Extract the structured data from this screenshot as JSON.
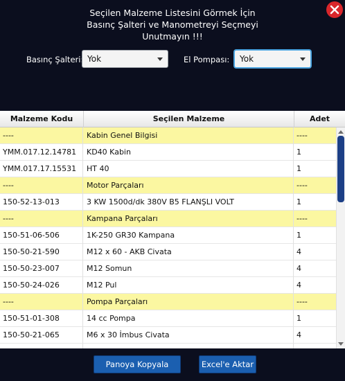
{
  "dialog": {
    "warning_lines": [
      "Seçilen Malzeme Listesini Görmek İçin",
      "Basınç Şalteri ve Manometreyi Seçmeyi",
      "Unutmayın !!!"
    ],
    "close_icon": "close-icon"
  },
  "filters": {
    "pressure_switch_label": "Basınç Şalteri:",
    "pressure_switch_value": "Yok",
    "hand_pump_label": "El Pompası:",
    "hand_pump_value": "Yok"
  },
  "table": {
    "columns": [
      "Malzeme Kodu",
      "Seçilen Malzeme",
      "Adet"
    ],
    "rows": [
      {
        "type": "section",
        "code": "----",
        "name": "Kabin Genel Bilgisi",
        "qty": "----"
      },
      {
        "type": "item",
        "code": "YMM.017.12.14781",
        "name": "KD40 Kabin",
        "qty": "1"
      },
      {
        "type": "item",
        "code": "YMM.017.17.15531",
        "name": "HT 40",
        "qty": "1"
      },
      {
        "type": "section",
        "code": "----",
        "name": "Motor Parçaları",
        "qty": "----"
      },
      {
        "type": "item",
        "code": "150-52-13-013",
        "name": "3 KW 1500d/dk 380V B5 FLANŞLI VOLT",
        "qty": "1"
      },
      {
        "type": "section",
        "code": "----",
        "name": "Kampana Parçaları",
        "qty": "----"
      },
      {
        "type": "item",
        "code": "150-51-06-506",
        "name": "1K-250 GR30 Kampana",
        "qty": "1"
      },
      {
        "type": "item",
        "code": "150-50-21-590",
        "name": "M12 x 60 - AKB Civata",
        "qty": "4"
      },
      {
        "type": "item",
        "code": "150-50-23-007",
        "name": "M12 Somun",
        "qty": "4"
      },
      {
        "type": "item",
        "code": "150-50-24-026",
        "name": "M12 Pul",
        "qty": "4"
      },
      {
        "type": "section",
        "code": "----",
        "name": "Pompa Parçaları",
        "qty": "----"
      },
      {
        "type": "item",
        "code": "150-51-01-308",
        "name": "14 cc Pompa",
        "qty": "1"
      },
      {
        "type": "item",
        "code": "150-50-21-065",
        "name": "M6 x 30 İmbus Civata",
        "qty": "4"
      },
      {
        "type": "item",
        "code": "",
        "name": "",
        "qty": ""
      }
    ]
  },
  "actions": {
    "copy_label": "Panoya Kopyala",
    "excel_label": "Excel'e Aktar"
  },
  "colors": {
    "background": "#0b0e1e",
    "section_row": "#fbf7a1",
    "button": "#1b5fb0",
    "scroll_thumb": "#1c3f86",
    "close": "#d9262b"
  }
}
